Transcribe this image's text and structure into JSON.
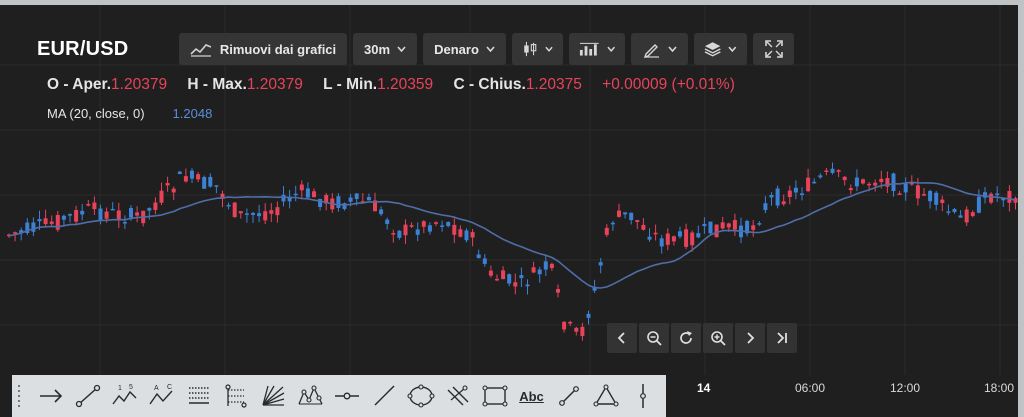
{
  "symbol": "EUR/USD",
  "toolbar": {
    "remove_label": "Rimuovi dai grafici",
    "interval_label": "30m",
    "price_label": "Denaro"
  },
  "ohlc": {
    "open_label": "O - Aper.",
    "open_value": "1.20379",
    "high_label": "H - Max.",
    "high_value": "1.20379",
    "low_label": "L - Min.",
    "low_value": "1.20359",
    "close_label": "C - Chius.",
    "close_value": "1.20375",
    "change": "+0.00009 (+0.01%)"
  },
  "indicator": {
    "label": "MA (20, close, 0)",
    "value": "1.2048"
  },
  "time_axis": {
    "labels": [
      "14",
      "06:00",
      "12:00",
      "18:00"
    ]
  },
  "drawing_tools": {
    "text_tool_label": "Abc"
  },
  "colors": {
    "up": "#3b82d6",
    "down": "#e8435a",
    "ma": "#4f6ea8",
    "background": "#1f1f1f",
    "grid": "#2b2b2b"
  },
  "chart_data": {
    "type": "candlestick",
    "series": [
      {
        "name": "MA (20, close, 0)",
        "values": [
          1.2048
        ]
      }
    ],
    "x": [
      "14",
      "06:00",
      "12:00",
      "18:00"
    ],
    "last": {
      "open": 1.20379,
      "high": 1.20379,
      "low": 1.20359,
      "close": 1.20375
    }
  }
}
